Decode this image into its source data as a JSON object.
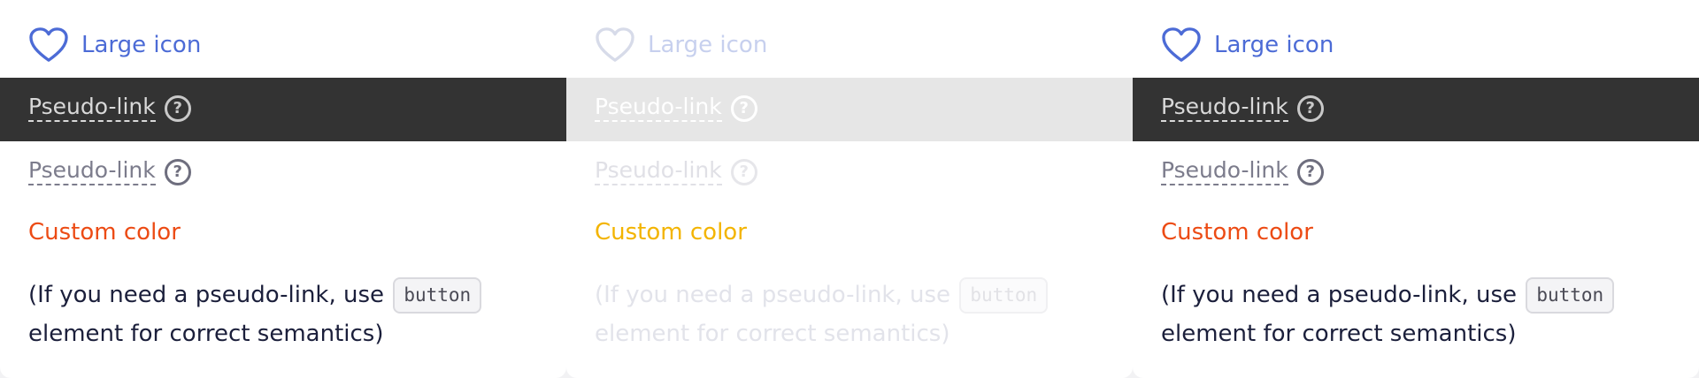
{
  "panels": [
    {
      "state": "normal",
      "large_icon_link": {
        "label": "Large icon",
        "icon": "heart-outline-icon"
      },
      "pseudo_link_dark": {
        "label": "Pseudo-link",
        "icon": "question-circle-icon"
      },
      "pseudo_link_light": {
        "label": "Pseudo-link",
        "icon": "question-circle-icon"
      },
      "custom_color_link": {
        "label": "Custom color",
        "color": "#ec4b14"
      },
      "note": {
        "before": "(If you need a pseudo-link, use ",
        "code": "button",
        "after": " element for correct semantics)"
      }
    },
    {
      "state": "disabled",
      "large_icon_link": {
        "label": "Large icon",
        "icon": "heart-outline-icon"
      },
      "pseudo_link_dark": {
        "label": "Pseudo-link",
        "icon": "question-circle-icon"
      },
      "pseudo_link_light": {
        "label": "Pseudo-link",
        "icon": "question-circle-icon"
      },
      "custom_color_link": {
        "label": "Custom color",
        "color": "#f3b400"
      },
      "note": {
        "before": "(If you need a pseudo-link, use ",
        "code": "button",
        "after": " element for correct semantics)"
      }
    },
    {
      "state": "normal",
      "large_icon_link": {
        "label": "Large icon",
        "icon": "heart-outline-icon"
      },
      "pseudo_link_dark": {
        "label": "Pseudo-link",
        "icon": "question-circle-icon"
      },
      "pseudo_link_light": {
        "label": "Pseudo-link",
        "icon": "question-circle-icon"
      },
      "custom_color_link": {
        "label": "Custom color",
        "color": "#ec4b14"
      },
      "note": {
        "before": "(If you need a pseudo-link, use ",
        "code": "button",
        "after": " element for correct semantics)"
      }
    }
  ],
  "colors": {
    "link_blue": "#4c6bd6",
    "dark_bar": "#333333",
    "text_dark": "#1b1f3b"
  }
}
